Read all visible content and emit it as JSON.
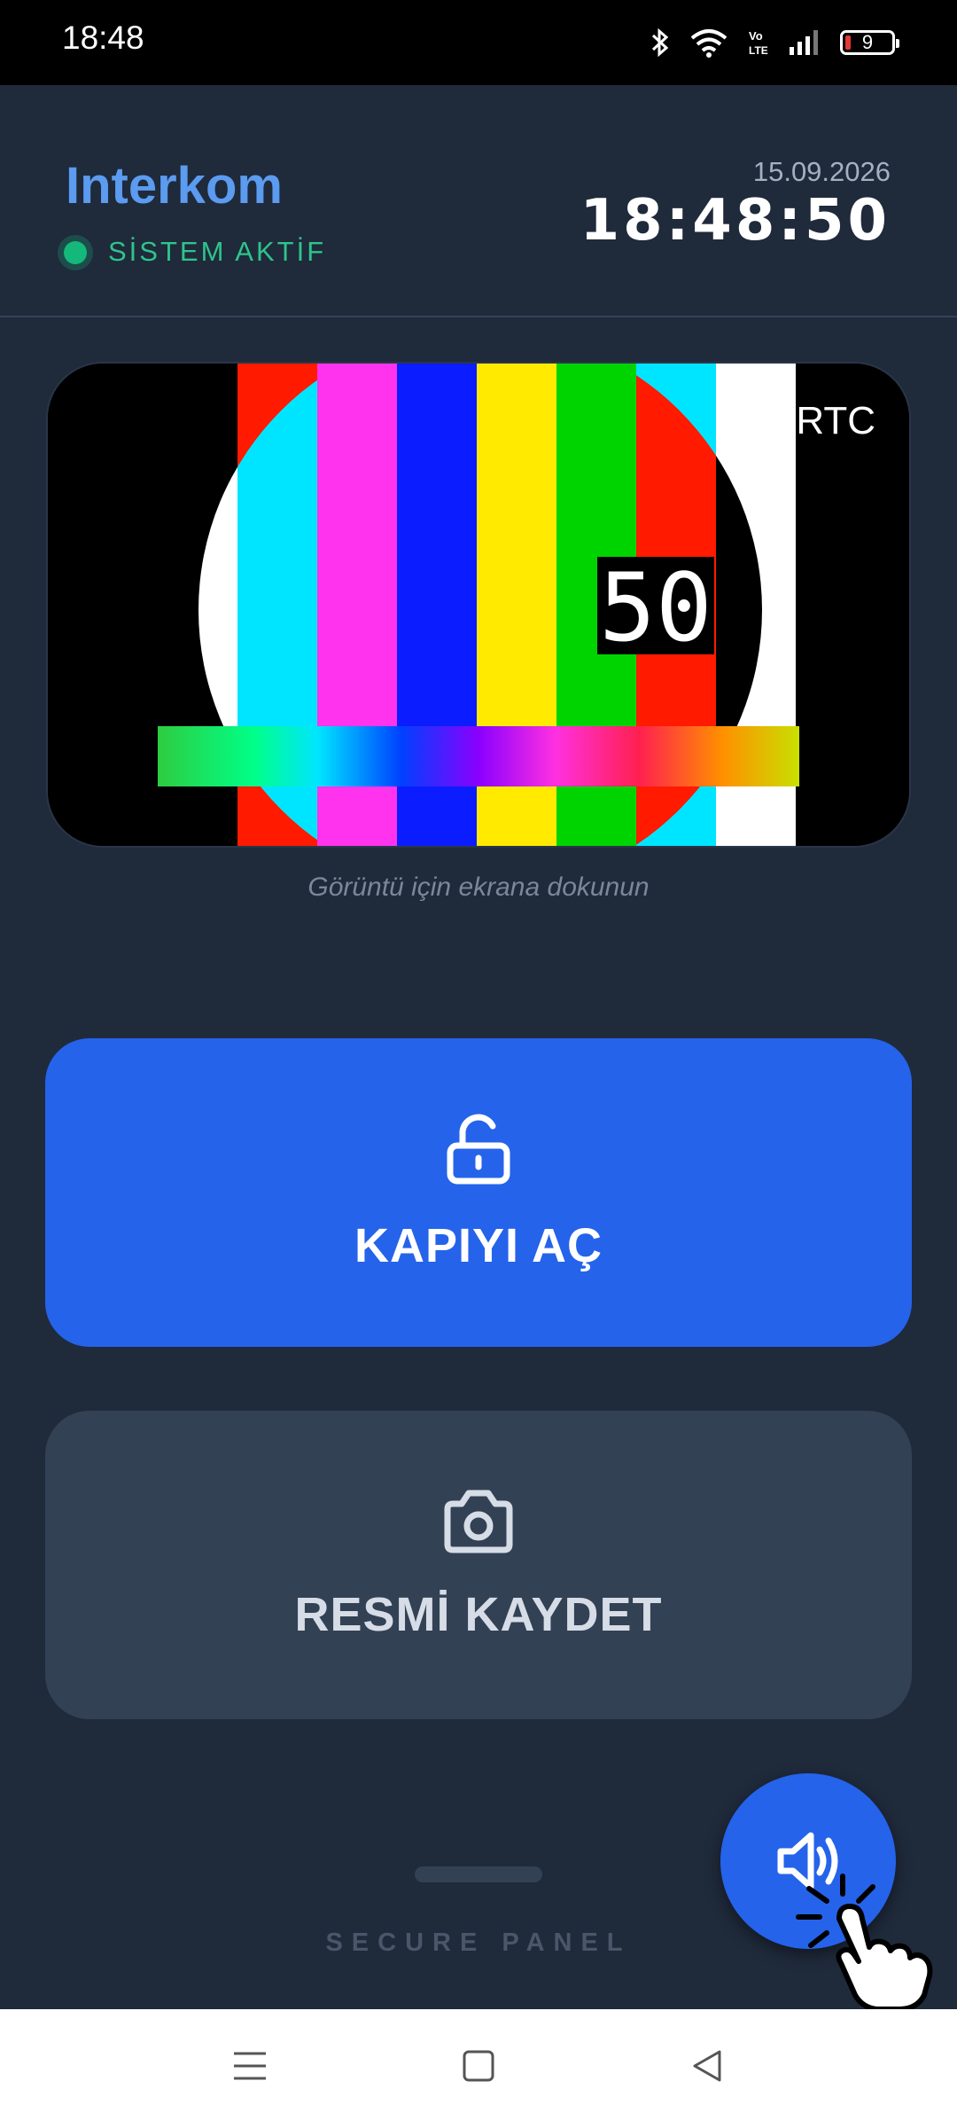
{
  "status_bar": {
    "time": "18:48",
    "battery_level": "9",
    "network_label": "Vo LTE",
    "icons": [
      "bluetooth-icon",
      "wifi-icon",
      "volte-icon",
      "signal-icon",
      "battery-icon"
    ]
  },
  "header": {
    "title": "Interkom",
    "status": "SİSTEM AKTİF",
    "date": "15.09.2026",
    "clock": "18:48:50"
  },
  "preview": {
    "overlay_label": "RTC",
    "counter": "50",
    "hint": "Görüntü için ekrana dokunun"
  },
  "actions": {
    "open_door": {
      "label": "KAPIYI AÇ",
      "icon": "unlock-icon"
    },
    "save_image": {
      "label": "RESMİ KAYDET",
      "icon": "camera-icon"
    }
  },
  "footer": {
    "label": "SECURE PANEL",
    "fab_icon": "speaker-icon"
  },
  "colors": {
    "background": "#1f2a3b",
    "accent": "#2563eb",
    "title": "#5b9bf0",
    "active": "#14b87a",
    "secondary_button": "#334155"
  }
}
